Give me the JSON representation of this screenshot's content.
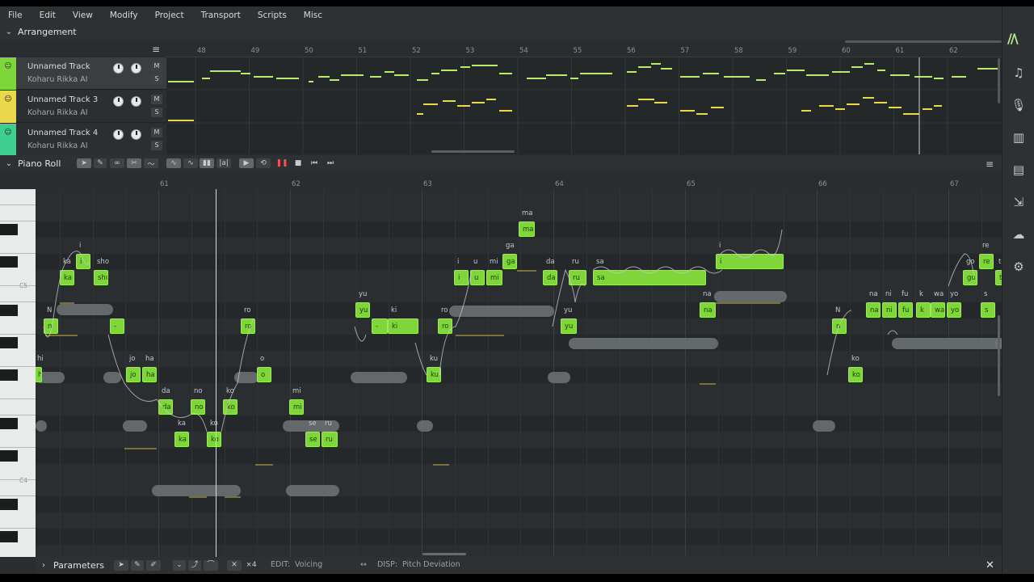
{
  "menu": [
    "File",
    "Edit",
    "View",
    "Modify",
    "Project",
    "Transport",
    "Scripts",
    "Misc"
  ],
  "arrangement": {
    "title": "Arrangement",
    "bars": [
      "48",
      "49",
      "50",
      "51",
      "52",
      "53",
      "54",
      "55",
      "56",
      "57",
      "58",
      "59",
      "60",
      "61",
      "62"
    ],
    "tracks": [
      {
        "name": "Unnamed Track",
        "voice": "Koharu Rikka AI",
        "color": "#7ed63a",
        "mute": "M",
        "solo": "S"
      },
      {
        "name": "Unnamed Track 3",
        "voice": "Koharu Rikka AI",
        "color": "#e9d84a",
        "mute": "M",
        "solo": "S"
      },
      {
        "name": "Unnamed Track 4",
        "voice": "Koharu Rikka AI",
        "color": "#3ecf8e",
        "mute": "M",
        "solo": "S"
      }
    ]
  },
  "piano_roll": {
    "title": "Piano Roll",
    "bars": [
      "61",
      "62",
      "63",
      "64",
      "65",
      "66",
      "67"
    ],
    "key_labels": [
      "C5",
      "C4"
    ],
    "notes": [
      {
        "lyric": "hi",
        "label": "hi",
        "lane": 11
      },
      {
        "lyric": "N",
        "label": "n",
        "lane": 8
      },
      {
        "lyric": "ka",
        "label": "ka",
        "lane": 5
      },
      {
        "lyric": "i",
        "label": "i",
        "lane": 4
      },
      {
        "lyric": "sho",
        "label": "sho",
        "lane": 5
      },
      {
        "lyric": "",
        "label": "-",
        "lane": 8
      },
      {
        "lyric": "jo",
        "label": "jo",
        "lane": 11
      },
      {
        "lyric": "ha",
        "label": "ha",
        "lane": 11
      },
      {
        "lyric": "da",
        "label": "da",
        "lane": 13
      },
      {
        "lyric": "ka",
        "label": "ka",
        "lane": 15
      },
      {
        "lyric": "no",
        "label": "no",
        "lane": 13
      },
      {
        "lyric": "ko",
        "label": "ko",
        "lane": 15
      },
      {
        "lyric": "ko",
        "label": "ko",
        "lane": 13
      },
      {
        "lyric": "ro",
        "label": "ro",
        "lane": 8
      },
      {
        "lyric": "o",
        "label": "o",
        "lane": 11
      },
      {
        "lyric": "mi",
        "label": "mi",
        "lane": 13
      },
      {
        "lyric": "se",
        "label": "se",
        "lane": 15
      },
      {
        "lyric": "ru",
        "label": "ru",
        "lane": 15
      },
      {
        "lyric": "yu",
        "label": "yu",
        "lane": 7
      },
      {
        "lyric": "",
        "label": "-",
        "lane": 8
      },
      {
        "lyric": "ki",
        "label": "ki",
        "lane": 8
      },
      {
        "lyric": "ku",
        "label": "ku",
        "lane": 11
      },
      {
        "lyric": "ro",
        "label": "ro",
        "lane": 8
      },
      {
        "lyric": "i",
        "label": "i",
        "lane": 5
      },
      {
        "lyric": "u",
        "label": "u",
        "lane": 5
      },
      {
        "lyric": "mi",
        "label": "mi",
        "lane": 5
      },
      {
        "lyric": "ga",
        "label": "ga",
        "lane": 4
      },
      {
        "lyric": "ma",
        "label": "ma",
        "lane": 2
      },
      {
        "lyric": "da",
        "label": "da",
        "lane": 5
      },
      {
        "lyric": "yu",
        "label": "yu",
        "lane": 8
      },
      {
        "lyric": "ru",
        "label": "ru",
        "lane": 5
      },
      {
        "lyric": "sa",
        "label": "sa",
        "lane": 5
      },
      {
        "lyric": "na",
        "label": "na",
        "lane": 7
      },
      {
        "lyric": "i",
        "label": "i",
        "lane": 4
      },
      {
        "lyric": "N",
        "label": "n",
        "lane": 8
      },
      {
        "lyric": "ko",
        "label": "ko",
        "lane": 11
      },
      {
        "lyric": "na",
        "label": "na",
        "lane": 7
      },
      {
        "lyric": "ni",
        "label": "ni",
        "lane": 7
      },
      {
        "lyric": "fu",
        "label": "fu",
        "lane": 7
      },
      {
        "lyric": "k",
        "label": "k",
        "lane": 7
      },
      {
        "lyric": "wa",
        "label": "wa",
        "lane": 7
      },
      {
        "lyric": "yo",
        "label": "yo",
        "lane": 7
      },
      {
        "lyric": "go",
        "label": "go",
        "lane": 5
      },
      {
        "lyric": "re",
        "label": "re",
        "lane": 4
      },
      {
        "lyric": "te",
        "label": "te",
        "lane": 5
      },
      {
        "lyric": "s",
        "label": "s",
        "lane": 7
      }
    ]
  },
  "parameters": {
    "title": "Parameters",
    "edit_label": "EDIT:",
    "edit_value": "Voicing",
    "disp_label": "DISP:",
    "disp_value": "Pitch Deviation",
    "multiplier": "×4",
    "close": "✕"
  },
  "icons": {
    "logo": "vocal-logo-icon",
    "sidebar": [
      "music-note-icon",
      "microphone-icon",
      "library-icon",
      "book-icon",
      "export-icon",
      "cloud-icon",
      "gear-icon"
    ]
  },
  "colors": {
    "note_fill": "#7ed63a",
    "note_border": "#9fe85f",
    "track1": "#7ed63a",
    "track3": "#e9d84a",
    "track4": "#3ecf8e"
  }
}
